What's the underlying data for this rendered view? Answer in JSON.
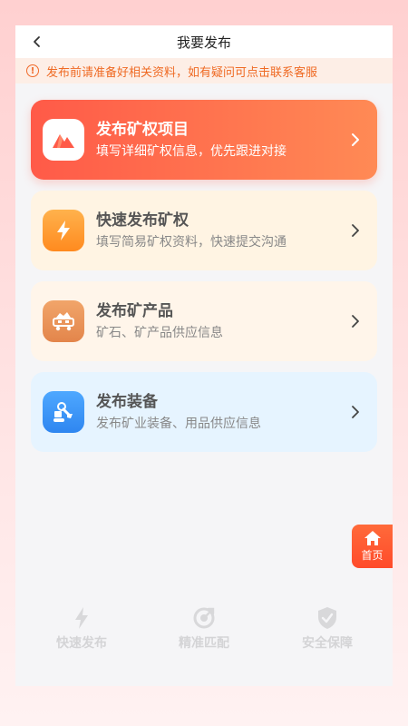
{
  "navbar": {
    "title": "我要发布"
  },
  "notice": {
    "text": "发布前请准备好相关资料，如有疑问可点击联系客服"
  },
  "cards": [
    {
      "title": "发布矿权项目",
      "subtitle": "填写详细矿权信息，优先跟进对接",
      "icon": "mountain-icon"
    },
    {
      "title": "快速发布矿权",
      "subtitle": "填写简易矿权资料，快速提交沟通",
      "icon": "lightning-icon"
    },
    {
      "title": "发布矿产品",
      "subtitle": "矿石、矿产品供应信息",
      "icon": "mine-cart-icon"
    },
    {
      "title": "发布装备",
      "subtitle": "发布矿业装备、用品供应信息",
      "icon": "excavator-icon"
    }
  ],
  "home_button": {
    "label": "首页",
    "icon": "home-icon"
  },
  "features": [
    {
      "label": "快速发布",
      "icon": "lightning-icon"
    },
    {
      "label": "精准匹配",
      "icon": "target-icon"
    },
    {
      "label": "安全保障",
      "icon": "shield-check-icon"
    }
  ],
  "colors": {
    "accent": "#ff5a48",
    "notice_text": "#ef6a23",
    "notice_bg": "#fdeee6"
  }
}
